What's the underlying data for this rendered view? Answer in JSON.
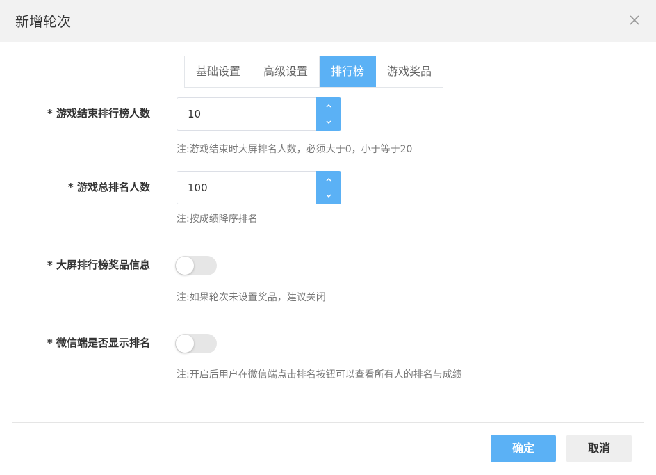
{
  "dialog": {
    "title": "新增轮次",
    "close_icon": "close-icon"
  },
  "tabs": [
    {
      "label": "基础设置",
      "active": false
    },
    {
      "label": "高级设置",
      "active": false
    },
    {
      "label": "排行榜",
      "active": true
    },
    {
      "label": "游戏奖品",
      "active": false
    }
  ],
  "form": {
    "end_rank_count": {
      "label": "* 游戏结束排行榜人数",
      "value": "10",
      "note": "注:游戏结束时大屏排名人数，必须大于0，小于等于20"
    },
    "total_rank_count": {
      "label": "* 游戏总排名人数",
      "value": "100",
      "note": "注:按成绩降序排名"
    },
    "screen_prize_info": {
      "label": "* 大屏排行榜奖品信息",
      "enabled": false,
      "note": "注:如果轮次未设置奖品，建议关闭"
    },
    "wechat_show_rank": {
      "label": "* 微信端是否显示排名",
      "enabled": false,
      "note": "注:开启后用户在微信端点击排名按钮可以查看所有人的排名与成绩"
    }
  },
  "footer": {
    "ok_label": "确定",
    "cancel_label": "取消"
  },
  "colors": {
    "accent": "#5bb1f5",
    "header_bg": "#f2f2f2",
    "switch_off": "#e6e6e6"
  }
}
